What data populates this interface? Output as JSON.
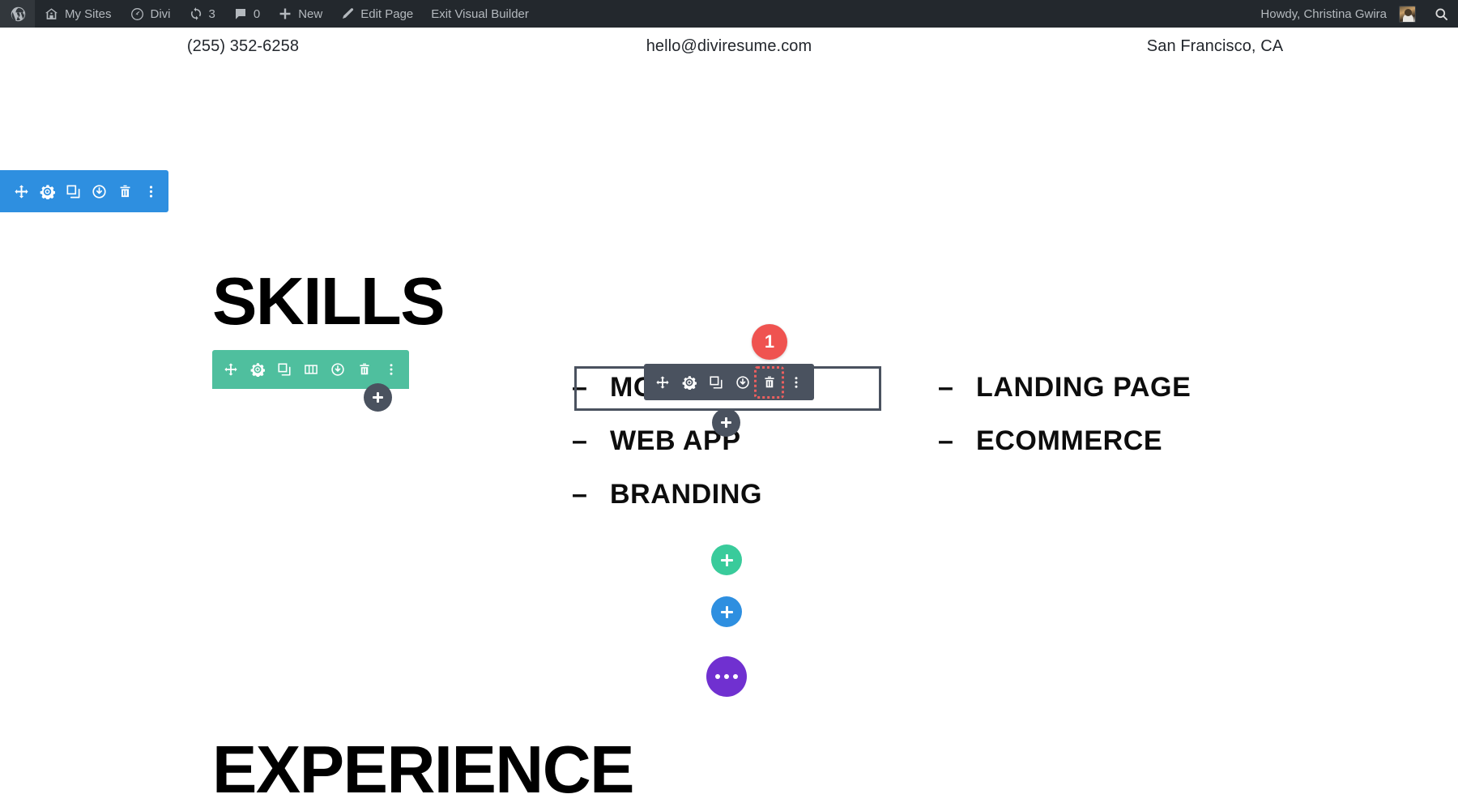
{
  "admin_bar": {
    "items": [
      {
        "id": "wp-logo",
        "icon": "wordpress-logo-icon",
        "label": ""
      },
      {
        "id": "my-sites",
        "icon": "sites-icon",
        "label": "My Sites"
      },
      {
        "id": "divi",
        "icon": "divi-icon",
        "label": "Divi"
      },
      {
        "id": "updates",
        "icon": "updates-icon",
        "label": "3"
      },
      {
        "id": "comments",
        "icon": "comment-bubble-icon",
        "label": "0"
      },
      {
        "id": "new",
        "icon": "plus-icon",
        "label": "New"
      },
      {
        "id": "edit-page",
        "icon": "pencil-icon",
        "label": "Edit Page"
      },
      {
        "id": "exit-visual-builder",
        "icon": "",
        "label": "Exit Visual Builder"
      }
    ],
    "account_greeting": "Howdy, Christina Gwira",
    "avatar_name": "avatar",
    "search_icon": "search-icon"
  },
  "contact_bar": {
    "phone": "(255) 352-6258",
    "email": "hello@diviresume.com",
    "location": "San Francisco, CA"
  },
  "content": {
    "skills_heading": "SKILLS",
    "experience_heading": "EXPERIENCE",
    "skills_left": [
      {
        "dash": "–",
        "label": "MOBILE APP"
      },
      {
        "dash": "–",
        "label": "WEB APP"
      },
      {
        "dash": "–",
        "label": "BRANDING"
      }
    ],
    "skills_right": [
      {
        "dash": "–",
        "label": "LANDING PAGE"
      },
      {
        "dash": "–",
        "label": "ECOMMERCE"
      }
    ]
  },
  "builder": {
    "section_toolbar": {
      "color": "#2e8fe0",
      "buttons": [
        {
          "name": "move-section-icon",
          "icon": "move"
        },
        {
          "name": "section-settings-icon",
          "icon": "gear"
        },
        {
          "name": "duplicate-section-icon",
          "icon": "duplicate"
        },
        {
          "name": "save-section-library-icon",
          "icon": "power"
        },
        {
          "name": "delete-section-icon",
          "icon": "trash"
        },
        {
          "name": "section-more-options-icon",
          "icon": "dots"
        }
      ]
    },
    "row_toolbar": {
      "color": "#4fbf9e",
      "buttons": [
        {
          "name": "move-row-icon",
          "icon": "move"
        },
        {
          "name": "row-settings-icon",
          "icon": "gear"
        },
        {
          "name": "duplicate-row-icon",
          "icon": "duplicate"
        },
        {
          "name": "row-columns-icon",
          "icon": "columns"
        },
        {
          "name": "save-row-library-icon",
          "icon": "power"
        },
        {
          "name": "delete-row-icon",
          "icon": "trash"
        },
        {
          "name": "row-more-options-icon",
          "icon": "dots"
        }
      ]
    },
    "module_toolbar": {
      "color": "#4a525f",
      "buttons": [
        {
          "name": "move-module-icon",
          "icon": "move",
          "highlighted": false
        },
        {
          "name": "module-settings-icon",
          "icon": "gear",
          "highlighted": false
        },
        {
          "name": "duplicate-module-icon",
          "icon": "duplicate",
          "highlighted": false
        },
        {
          "name": "save-module-library-icon",
          "icon": "power",
          "highlighted": false
        },
        {
          "name": "delete-module-icon",
          "icon": "trash",
          "highlighted": true
        },
        {
          "name": "module-more-options-icon",
          "icon": "dots",
          "highlighted": false
        }
      ],
      "highlight_color": "#ec5f5f"
    },
    "step_badge": {
      "text": "1",
      "color": "#ef5350"
    },
    "add_buttons": [
      {
        "name": "add-module-inline-button",
        "glyph": "+",
        "color": "#4a525f"
      },
      {
        "name": "add-row-inline-button",
        "glyph": "+",
        "color": "#4a525f"
      },
      {
        "name": "add-new-row-button",
        "glyph": "+",
        "color": "#39cb9b"
      },
      {
        "name": "add-new-section-button",
        "glyph": "+",
        "color": "#2e8fe0"
      },
      {
        "name": "add-specialty-section-button",
        "glyph": "…",
        "color": "#7030d0"
      }
    ]
  }
}
